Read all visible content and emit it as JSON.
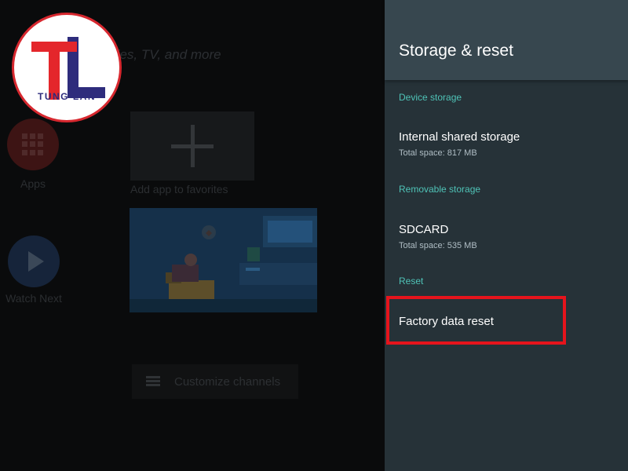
{
  "home": {
    "search_text": "Search movies, TV, and more",
    "apps_label": "Apps",
    "watch_next_label": "Watch Next",
    "add_app_label": "Add app to favorites",
    "customize_label": "Customize channels"
  },
  "logo": {
    "text": "TUNG LAN",
    "colors": {
      "red": "#e4262b",
      "navy": "#2e2c7c"
    }
  },
  "panel": {
    "title": "Storage & reset",
    "sections": {
      "device_storage": "Device storage",
      "removable_storage": "Removable storage",
      "reset": "Reset"
    },
    "internal": {
      "title": "Internal shared storage",
      "subtitle": "Total space: 817 MB"
    },
    "sdcard": {
      "title": "SDCARD",
      "subtitle": "Total space: 535 MB"
    },
    "factory_reset": {
      "title": "Factory data reset"
    }
  },
  "colors": {
    "panel_bg": "#263238",
    "panel_header": "#37474f",
    "section_accent": "#4fc3b7",
    "highlight": "#e6141c"
  },
  "icons": [
    "google-assistant-icon",
    "apps-grid-icon",
    "play-icon",
    "plus-icon",
    "list-icon"
  ]
}
